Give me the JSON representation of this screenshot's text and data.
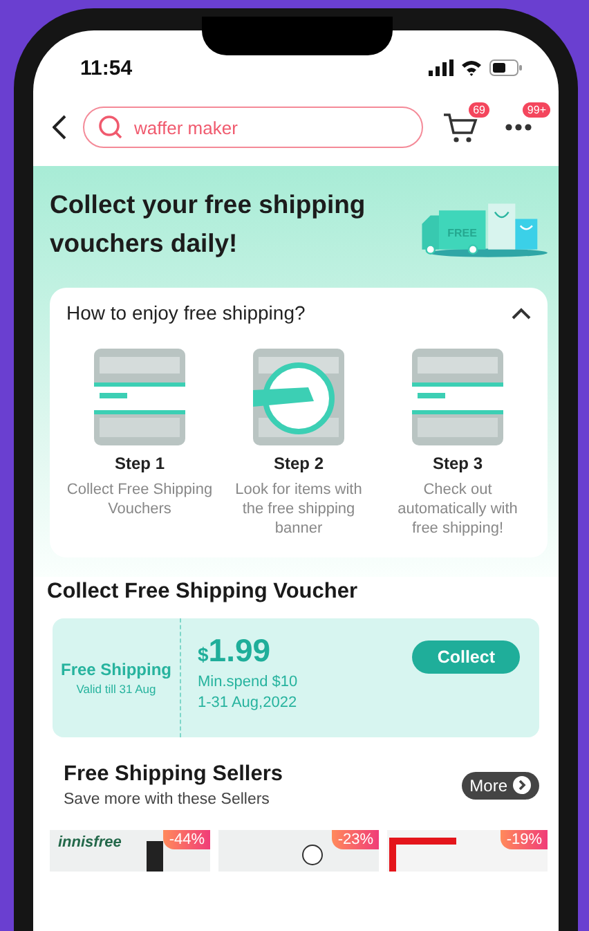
{
  "status_bar": {
    "time": "11:54"
  },
  "header": {
    "search_value": "waffer maker",
    "cart_badge": "69",
    "more_badge": "99+"
  },
  "banner": {
    "title": "Collect your free shipping vouchers daily!",
    "truck_label": "FREE"
  },
  "how_to": {
    "title": "How to enjoy free shipping?",
    "expanded": true,
    "steps": [
      {
        "title": "Step 1",
        "text": "Collect Free Shipping Vouchers"
      },
      {
        "title": "Step 2",
        "text": "Look for items with the free shipping banner"
      },
      {
        "title": "Step 3",
        "text": "Check out automatically with free shipping!"
      }
    ]
  },
  "voucher_section": {
    "title": "Collect Free Shipping Voucher",
    "voucher": {
      "label": "Free Shipping",
      "validity": "Valid till 31 Aug",
      "currency": "$",
      "amount": "1.99",
      "min_spend": "Min.spend $10",
      "dates": "1-31 Aug,2022",
      "button": "Collect"
    }
  },
  "sellers": {
    "title": "Free Shipping Sellers",
    "subtitle": "Save more with these Sellers",
    "more": "More",
    "items": [
      {
        "brand": "innisfree",
        "discount": "-44%"
      },
      {
        "discount": "-23%"
      },
      {
        "discount": "-19%"
      }
    ]
  }
}
